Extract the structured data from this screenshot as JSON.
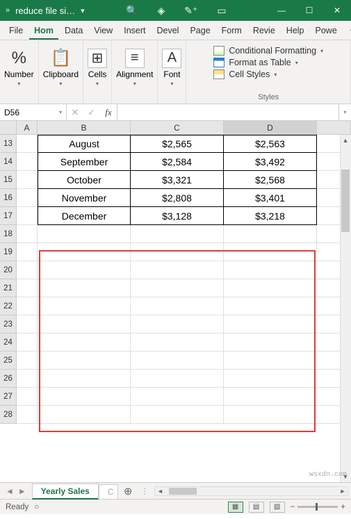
{
  "titlebar": {
    "filename": "reduce file si…"
  },
  "tabs": {
    "file": "File",
    "home": "Hom",
    "data": "Data",
    "view": "View",
    "insert": "Insert",
    "devel": "Devel",
    "page": "Page",
    "form": "Form",
    "revie": "Revie",
    "help": "Help",
    "powe": "Powe"
  },
  "ribbon": {
    "number": "Number",
    "clipboard": "Clipboard",
    "cells": "Cells",
    "alignment": "Alignment",
    "font": "Font",
    "styles_label": "Styles",
    "cond_fmt": "Conditional Formatting",
    "as_table": "Format as Table",
    "cell_styles": "Cell Styles"
  },
  "namebox_value": "D56",
  "columns": {
    "A": "A",
    "B": "B",
    "C": "C",
    "D": "D"
  },
  "rows": [
    "13",
    "14",
    "15",
    "16",
    "17",
    "18",
    "19",
    "20",
    "21",
    "22",
    "23",
    "24",
    "25",
    "26",
    "27",
    "28"
  ],
  "data": [
    {
      "b": "August",
      "c": "$2,565",
      "d": "$2,563"
    },
    {
      "b": "September",
      "c": "$2,584",
      "d": "$3,492"
    },
    {
      "b": "October",
      "c": "$3,321",
      "d": "$2,568"
    },
    {
      "b": "November",
      "c": "$2,808",
      "d": "$3,401"
    },
    {
      "b": "December",
      "c": "$3,128",
      "d": "$3,218"
    }
  ],
  "sheets": {
    "active": "Yearly Sales",
    "partial": "C",
    "next": "…"
  },
  "status": {
    "ready": "Ready"
  },
  "watermark": "wsxdn.com",
  "glyph": {
    "pct": "%",
    "search": "🔍",
    "diamond": "◈",
    "wand": "✎⁺",
    "rect": "▭",
    "min": "—",
    "max": "☐",
    "close": "✕",
    "down": "▾",
    "dots": "⋯",
    "plus": "⊕",
    "left": "◄",
    "right": "►",
    "up": "▲",
    "dn": "▼",
    "paste": "📋",
    "cells_i": "⊞",
    "align": "≡",
    "font_a": "A",
    "check": "✓",
    "x": "✕",
    "fx": "fx",
    "zminus": "−",
    "zplus": "+",
    "collapse": "▽",
    "grid": "▦",
    "page": "▤",
    "break": "▧",
    "play": "▶",
    "circle": "○",
    "chev": "»"
  }
}
